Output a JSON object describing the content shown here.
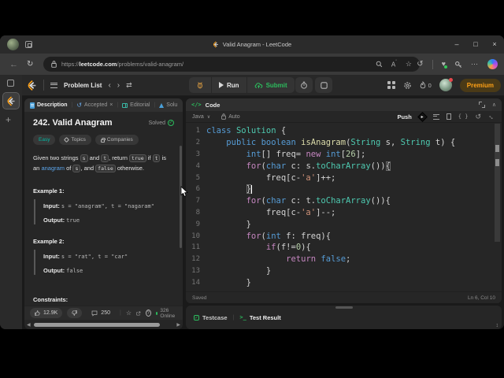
{
  "window": {
    "title": "Valid Anagram - LeetCode",
    "url_prefix": "https://",
    "url_host": "leetcode.com",
    "url_path": "/problems/valid-anagram/"
  },
  "navbar": {
    "problem_list": "Problem List",
    "run": "Run",
    "submit": "Submit",
    "streak_count": "0",
    "premium": "Premium"
  },
  "description_panel": {
    "tabs": {
      "description": "Description",
      "accepted": "Accepted",
      "editorial": "Editorial",
      "solutions": "Solu"
    },
    "title": "242. Valid Anagram",
    "solved_label": "Solved",
    "badges": {
      "difficulty": "Easy",
      "topics": "Topics",
      "companies": "Companies"
    },
    "statement_tokens": [
      [
        "Given two strings ",
        "t"
      ],
      [
        "s",
        "c"
      ],
      [
        " and ",
        "t"
      ],
      [
        "t",
        "c"
      ],
      [
        ", return ",
        "t"
      ],
      [
        "true",
        "c"
      ],
      [
        " if ",
        "t"
      ],
      [
        "t",
        "c"
      ],
      [
        " is an ",
        "t"
      ],
      [
        "anagram",
        "link"
      ],
      [
        " of ",
        "t"
      ],
      [
        "s",
        "c"
      ],
      [
        ", and ",
        "t"
      ],
      [
        "false",
        "c"
      ],
      [
        " otherwise.",
        "t"
      ]
    ],
    "examples": [
      {
        "label": "Example 1:",
        "input_label": "Input:",
        "input": "s = \"anagram\", t = \"nagaram\"",
        "output_label": "Output:",
        "output": "true"
      },
      {
        "label": "Example 2:",
        "input_label": "Input:",
        "input": "s = \"rat\", t = \"car\"",
        "output_label": "Output:",
        "output": "false"
      }
    ],
    "constraints_label": "Constraints:",
    "footer": {
      "likes": "12.9K",
      "comments": "250",
      "online": "326 Online"
    }
  },
  "code_panel": {
    "header": "Code",
    "code_tag": "</>",
    "language": "Java",
    "auto_label": "Auto",
    "push_label": "Push",
    "status_saved": "Saved",
    "status_position": "Ln 6, Col 10",
    "cursor_line": 6,
    "lines": [
      [
        [
          "class",
          "kw"
        ],
        [
          " ",
          "p"
        ],
        [
          "Solution",
          "type"
        ],
        [
          " {",
          "p"
        ]
      ],
      [
        [
          "    ",
          "p"
        ],
        [
          "public",
          "kw"
        ],
        [
          " ",
          "p"
        ],
        [
          "boolean",
          "kw"
        ],
        [
          " ",
          "p"
        ],
        [
          "isAnagram",
          "fn"
        ],
        [
          "(",
          "p"
        ],
        [
          "String",
          "type"
        ],
        [
          " s, ",
          "p"
        ],
        [
          "String",
          "type"
        ],
        [
          " t) {",
          "p"
        ]
      ],
      [
        [
          "        ",
          "p"
        ],
        [
          "int",
          "kw"
        ],
        [
          "[] freq= ",
          "p"
        ],
        [
          "new",
          "ctrl"
        ],
        [
          " ",
          "p"
        ],
        [
          "int",
          "kw"
        ],
        [
          "[",
          "p"
        ],
        [
          "26",
          "num"
        ],
        [
          "];",
          "p"
        ]
      ],
      [
        [
          "        ",
          "p"
        ],
        [
          "for",
          "ctrl"
        ],
        [
          "(",
          "p"
        ],
        [
          "char",
          "kw"
        ],
        [
          " c: s.",
          "p"
        ],
        [
          "toCharArray",
          "type"
        ],
        [
          "())",
          "p"
        ],
        [
          "{",
          "bm"
        ]
      ],
      [
        [
          "            freq[c-",
          "p"
        ],
        [
          "'a'",
          "str"
        ],
        [
          "]++;",
          "p"
        ]
      ],
      [
        [
          "        ",
          "p"
        ],
        [
          "}",
          "bm"
        ]
      ],
      [
        [
          "        ",
          "p"
        ],
        [
          "for",
          "ctrl"
        ],
        [
          "(",
          "p"
        ],
        [
          "char",
          "kw"
        ],
        [
          " c: t.",
          "p"
        ],
        [
          "toCharArray",
          "type"
        ],
        [
          "()){",
          "p"
        ]
      ],
      [
        [
          "            freq[c-",
          "p"
        ],
        [
          "'a'",
          "str"
        ],
        [
          "]--;",
          "p"
        ]
      ],
      [
        [
          "        }",
          "p"
        ]
      ],
      [
        [
          "        ",
          "p"
        ],
        [
          "for",
          "ctrl"
        ],
        [
          "(",
          "p"
        ],
        [
          "int",
          "kw"
        ],
        [
          " f: freq){",
          "p"
        ]
      ],
      [
        [
          "            ",
          "p"
        ],
        [
          "if",
          "ctrl"
        ],
        [
          "(f!=",
          "p"
        ],
        [
          "0",
          "num"
        ],
        [
          "){",
          "p"
        ]
      ],
      [
        [
          "                ",
          "p"
        ],
        [
          "return",
          "ctrl"
        ],
        [
          " ",
          "p"
        ],
        [
          "false",
          "kw"
        ],
        [
          ";",
          "p"
        ]
      ],
      [
        [
          "            }",
          "p"
        ]
      ],
      [
        [
          "        }",
          "p"
        ]
      ]
    ]
  },
  "console_panel": {
    "testcase": "Testcase",
    "test_result": "Test Result"
  },
  "colors": {
    "accent_green": "#2cbb5d",
    "easy_teal": "#00b8a3",
    "premium_orange": "#ffa116",
    "link_blue": "#5ba3e8"
  }
}
